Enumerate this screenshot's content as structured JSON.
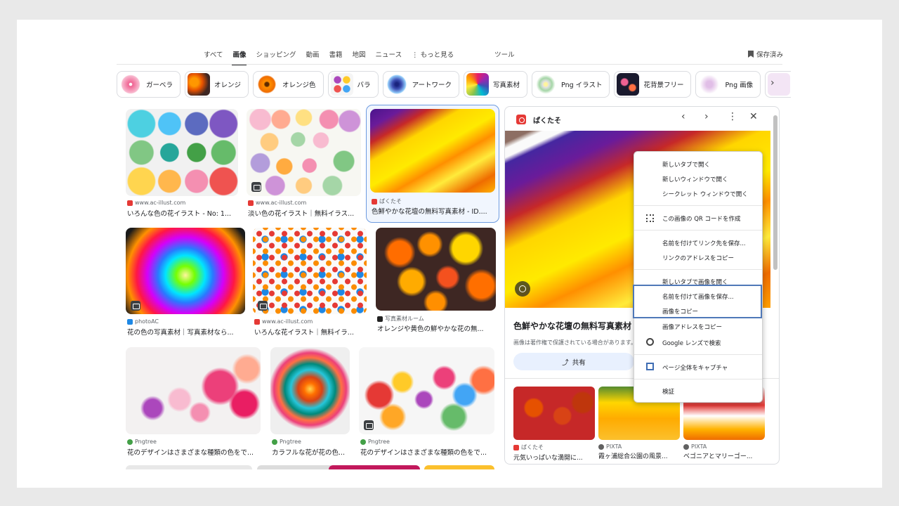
{
  "nav": {
    "tabs": [
      "すべて",
      "画像",
      "ショッピング",
      "動画",
      "書籍",
      "地図",
      "ニュース",
      "⋮ もっと見る"
    ],
    "active": "画像",
    "tools": "ツール",
    "saved": "保存済み"
  },
  "chips": [
    "ガーベラ",
    "オレンジ",
    "オレンジ色",
    "バラ",
    "アートワーク",
    "写真素材",
    "Png イラスト",
    "花背景フリー",
    "Png 画像"
  ],
  "results": [
    {
      "source": "www.ac-illust.com",
      "title": "いろんな色の花イラスト - No: 1..."
    },
    {
      "source": "www.ac-illust.com",
      "title": "淡い色の花イラスト｜無料イラス..."
    },
    {
      "source": "ぱくたそ",
      "title": "色鮮やかな花壇の無料写真素材 - ID...."
    },
    {
      "source": "photoAC",
      "title": "花の色の写真素材｜写真素材なら..."
    },
    {
      "source": "www.ac-illust.com",
      "title": "いろんな花イラスト｜無料イラ..."
    },
    {
      "source": "写真素材ルーム",
      "title": "オレンジや黄色の鮮やかな花の無..."
    },
    {
      "source": "Pngtree",
      "title": "花のデザインはさまざまな種類の色をで..."
    },
    {
      "source": "Pngtree",
      "title": "カラフルな花が花の色..."
    },
    {
      "source": "Pngtree",
      "title": "花のデザインはさまざまな種類の色をで..."
    }
  ],
  "panel": {
    "site": "ぱくたそ",
    "title": "色鮮やかな花壇の無料写真素材",
    "note": "画像は著作権で保護されている場合があります。",
    "share": "共有",
    "related": [
      {
        "source": "ぱくたそ",
        "title": "元気いっぱいな満開に..."
      },
      {
        "source": "PIXTA",
        "title": "霞ヶ浦総合公園の風景..."
      },
      {
        "source": "PIXTA",
        "title": "ベゴニアとマリーゴー..."
      }
    ]
  },
  "context_menu": [
    "新しいタブで開く",
    "新しいウィンドウで開く",
    "シークレット ウィンドウで開く",
    "この画像の QR コードを作成",
    "名前を付けてリンク先を保存...",
    "リンクのアドレスをコピー",
    "新しいタブで画像を開く",
    "名前を付けて画像を保存...",
    "画像をコピー",
    "画像アドレスをコピー",
    "Google レンズで検索",
    "ページ全体をキャプチャ",
    "検証"
  ],
  "colors": {
    "accent": "#4f78b8",
    "selected": "#6d9be0",
    "share_bg": "#e8f0fe"
  }
}
